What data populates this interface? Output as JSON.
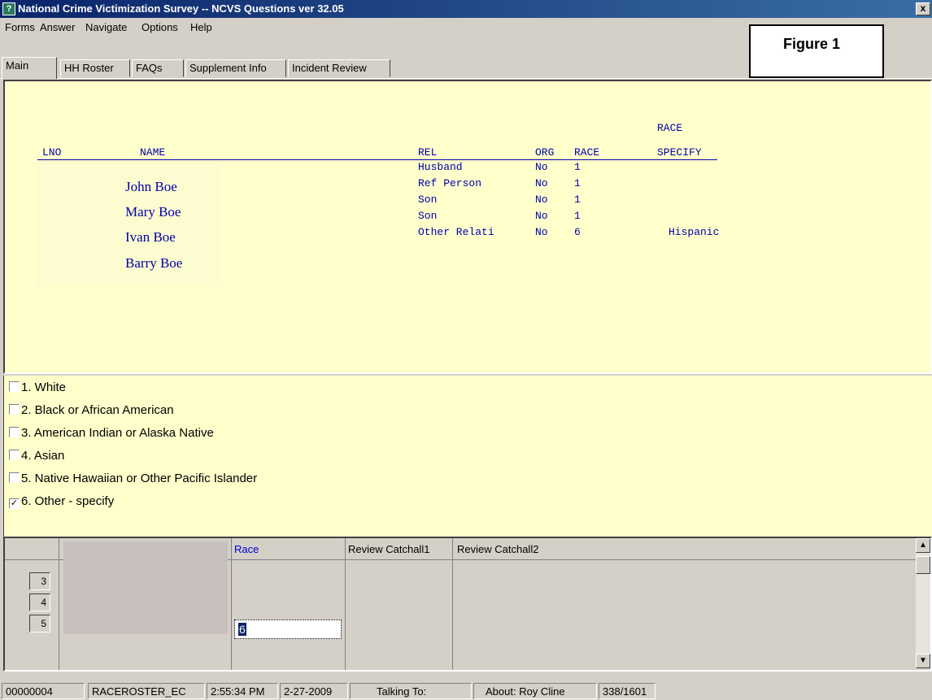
{
  "window": {
    "title": "National Crime Victimization Survey -- NCVS Questions ver 32.05",
    "close_glyph": "x"
  },
  "menu": [
    "Forms",
    "Answer",
    "Navigate",
    "Options",
    "Help"
  ],
  "figure_label": "Figure 1",
  "tabs": [
    "Main",
    "HH Roster",
    "FAQs",
    "Supplement Info",
    "Incident Review"
  ],
  "roster": {
    "headers": {
      "lno": "LNO",
      "name": "NAME",
      "rel": "REL",
      "org": "ORG",
      "race": "RACE",
      "race_specify_1": "RACE",
      "race_specify_2": "SPECIFY"
    },
    "names": [
      "John Boe",
      "Mary Boe",
      "Ivan Boe",
      "Barry Boe"
    ],
    "rows": [
      {
        "rel": "Husband",
        "org": "No",
        "race": "1",
        "specify": ""
      },
      {
        "rel": "Ref Person",
        "org": "No",
        "race": "1",
        "specify": ""
      },
      {
        "rel": "Son",
        "org": "No",
        "race": "1",
        "specify": ""
      },
      {
        "rel": "Son",
        "org": "No",
        "race": "1",
        "specify": ""
      },
      {
        "rel": "Other Relati",
        "org": "No",
        "race": "6",
        "specify": "Hispanic"
      }
    ]
  },
  "options": [
    {
      "label": "1. White",
      "checked": false
    },
    {
      "label": "2. Black or African American",
      "checked": false
    },
    {
      "label": "3. American Indian or Alaska Native",
      "checked": false
    },
    {
      "label": "4. Asian",
      "checked": false
    },
    {
      "label": "5. Native Hawaiian or Other Pacific Islander",
      "checked": false
    },
    {
      "label": "6. Other - specify",
      "checked": true
    }
  ],
  "checkmark": "✓",
  "grid": {
    "headers": {
      "race": "Race",
      "catchall1": "Review Catchall1",
      "catchall2": "Review Catchall2"
    },
    "row_numbers": [
      "3",
      "4",
      "5"
    ],
    "race_value": "6",
    "header_color": "#0000cc"
  },
  "scroll": {
    "up": "▲",
    "down": "▼"
  },
  "status": {
    "id": "00000004",
    "field": "RACEROSTER_EC",
    "time": "2:55:34 PM",
    "date": "2-27-2009",
    "talking_to": "Talking To:",
    "about": "About:  Roy Cline",
    "progress": "338/1601"
  }
}
